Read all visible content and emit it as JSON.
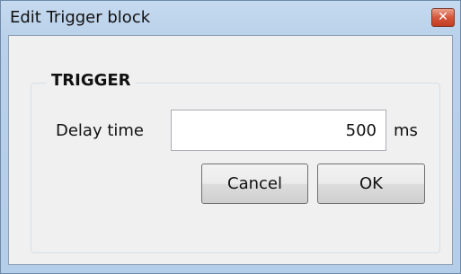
{
  "window": {
    "title": "Edit Trigger block",
    "close_symbol": "✕"
  },
  "group": {
    "label": "TRIGGER"
  },
  "delay": {
    "label": "Delay time",
    "value": "500",
    "unit": "ms"
  },
  "buttons": {
    "cancel_label": "Cancel",
    "ok_label": "OK"
  },
  "icons": {
    "close": "close-icon"
  },
  "colors": {
    "titlebar": "#b9d1ea",
    "close_button": "#d5563a",
    "client_background": "#f0f0f0"
  }
}
